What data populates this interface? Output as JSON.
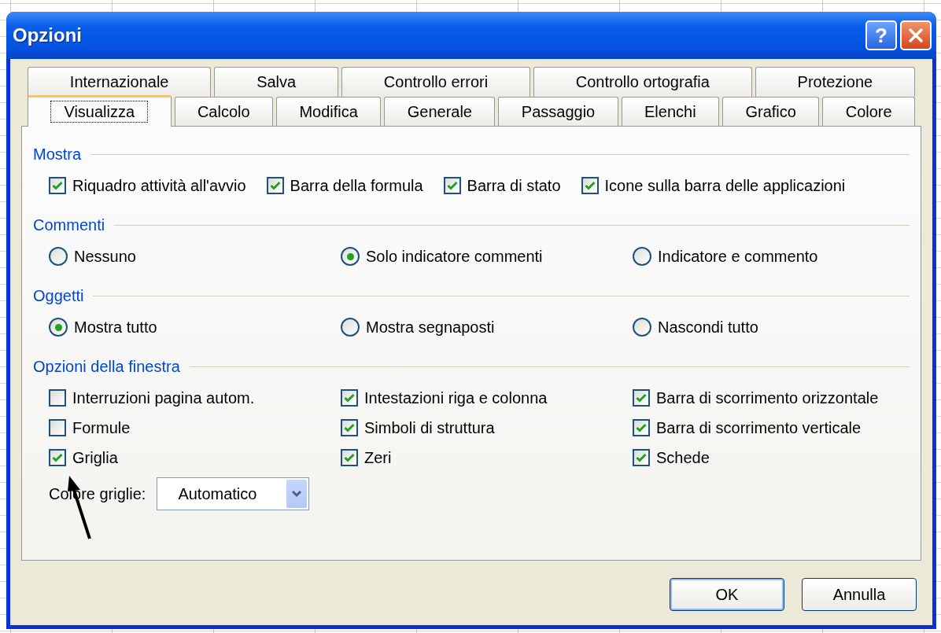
{
  "window": {
    "title": "Opzioni",
    "help_button": "?"
  },
  "tab_rows": [
    [
      {
        "label": "Internazionale",
        "selected": false
      },
      {
        "label": "Salva",
        "selected": false
      },
      {
        "label": "Controllo errori",
        "selected": false
      },
      {
        "label": "Controllo ortografia",
        "selected": false
      },
      {
        "label": "Protezione",
        "selected": false
      }
    ],
    [
      {
        "label": "Visualizza",
        "selected": true
      },
      {
        "label": "Calcolo",
        "selected": false
      },
      {
        "label": "Modifica",
        "selected": false
      },
      {
        "label": "Generale",
        "selected": false
      },
      {
        "label": "Passaggio",
        "selected": false
      },
      {
        "label": "Elenchi",
        "selected": false
      },
      {
        "label": "Grafico",
        "selected": false
      },
      {
        "label": "Colore",
        "selected": false
      }
    ]
  ],
  "sections": [
    {
      "heading": "Mostra",
      "kind": "inline",
      "items": [
        {
          "kind": "checkbox",
          "label": "Riquadro attività all'avvio",
          "checked": true
        },
        {
          "kind": "checkbox",
          "label": "Barra della formula",
          "checked": true
        },
        {
          "kind": "checkbox",
          "label": "Barra di stato",
          "checked": true
        },
        {
          "kind": "checkbox",
          "label": "Icone sulla barra delle applicazioni",
          "checked": true
        }
      ]
    },
    {
      "heading": "Commenti",
      "kind": "columns",
      "items": [
        {
          "kind": "radio",
          "label": "Nessuno",
          "selected": false
        },
        {
          "kind": "radio",
          "label": "Solo indicatore commenti",
          "selected": true
        },
        {
          "kind": "radio",
          "label": "Indicatore e commento",
          "selected": false
        }
      ]
    },
    {
      "heading": "Oggetti",
      "kind": "columns",
      "items": [
        {
          "kind": "radio",
          "label": "Mostra tutto",
          "selected": true
        },
        {
          "kind": "radio",
          "label": "Mostra segnaposti",
          "selected": false
        },
        {
          "kind": "radio",
          "label": "Nascondi tutto",
          "selected": false
        }
      ]
    },
    {
      "heading": "Opzioni della finestra",
      "kind": "columns",
      "items": [
        {
          "kind": "checkbox",
          "label": "Interruzioni pagina autom.",
          "checked": false
        },
        {
          "kind": "checkbox",
          "label": "Intestazioni riga e colonna",
          "checked": true
        },
        {
          "kind": "checkbox",
          "label": "Barra di scorrimento orizzontale",
          "checked": true
        },
        {
          "kind": "checkbox",
          "label": "Formule",
          "checked": false
        },
        {
          "kind": "checkbox",
          "label": "Simboli di struttura",
          "checked": true
        },
        {
          "kind": "checkbox",
          "label": "Barra di scorrimento verticale",
          "checked": true
        },
        {
          "kind": "checkbox",
          "label": "Griglia",
          "checked": true
        },
        {
          "kind": "checkbox",
          "label": "Zeri",
          "checked": true
        },
        {
          "kind": "checkbox",
          "label": "Schede",
          "checked": true
        }
      ],
      "dropdown": {
        "label": "Colore griglie:",
        "value": "Automatico"
      }
    }
  ],
  "buttons": [
    {
      "label": "OK",
      "default": true
    },
    {
      "label": "Annulla",
      "default": false
    }
  ]
}
